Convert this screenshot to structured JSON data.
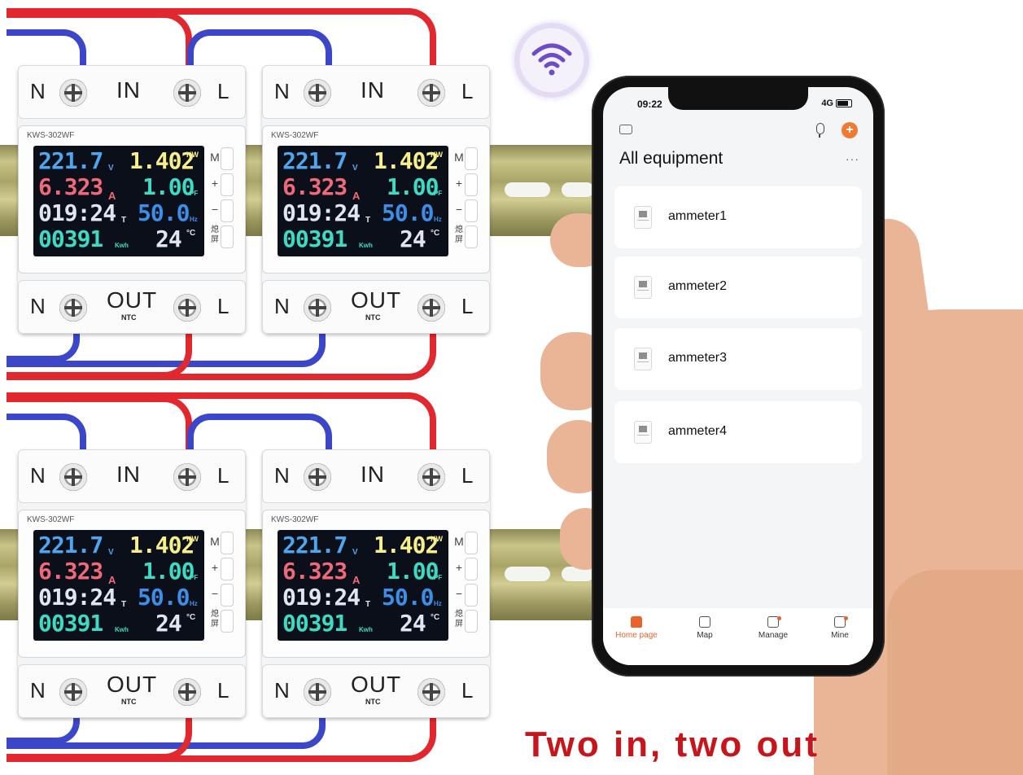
{
  "meters": [
    {
      "id": "m1"
    },
    {
      "id": "m2"
    },
    {
      "id": "m3"
    },
    {
      "id": "m4"
    }
  ],
  "meter_common": {
    "model": "KWS-302WF",
    "in_label": "IN",
    "out_label": "OUT",
    "ntc_label": "NTC",
    "neutral_label": "N",
    "line_label": "L",
    "voltage": "221.7",
    "voltage_unit": "V",
    "current": "6.323",
    "current_unit": "A",
    "time": "019:24",
    "time_unit": "T",
    "energy": "00391",
    "energy_unit": "Kwh",
    "power": "1.402",
    "power_unit": "KW",
    "pf": "1.00",
    "pf_unit": "PF",
    "frequency": "50.0",
    "frequency_unit": "Hz",
    "temperature": "24",
    "temperature_unit": "°C",
    "button_m": "M",
    "button_plus": "+",
    "button_minus": "−",
    "button_screen": "熄屏"
  },
  "phone": {
    "status_time": "09:22",
    "network": "4G",
    "page_title": "All equipment",
    "more": "···",
    "devices": [
      {
        "name": "ammeter1"
      },
      {
        "name": "ammeter2"
      },
      {
        "name": "ammeter3"
      },
      {
        "name": "ammeter4"
      }
    ],
    "tabs": [
      {
        "label": "Home page",
        "icon": "home-icon"
      },
      {
        "label": "Map",
        "icon": "map-icon"
      },
      {
        "label": "Manage",
        "icon": "manage-icon"
      },
      {
        "label": "Mine",
        "icon": "profile-icon"
      }
    ]
  },
  "caption": "Two in, two out",
  "colors": {
    "accent": "#e8642c",
    "caption": "#c8141b",
    "wire_live": "#e0282e",
    "wire_neutral": "#3b46c8"
  }
}
